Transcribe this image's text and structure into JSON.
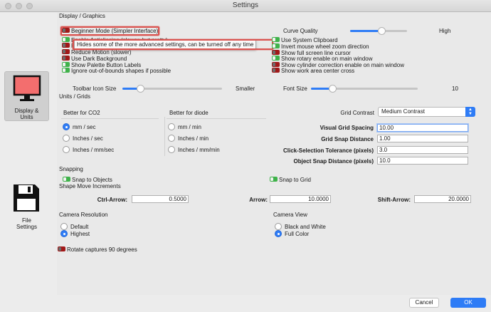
{
  "window": {
    "title": "Settings"
  },
  "sidebar": {
    "items": [
      {
        "label_1": "Display &",
        "label_2": "Units",
        "icon": "monitor-icon",
        "active": true
      },
      {
        "label_1": "File",
        "label_2": "Settings",
        "icon": "floppy-disk-icon",
        "active": false
      }
    ]
  },
  "display": {
    "header": "Display / Graphics",
    "left_checks": [
      {
        "label": "Beginner Mode (Simpler Interface)",
        "on": false
      },
      {
        "label": "Enable Antialiasing (slower, but pretty)",
        "on": true
      },
      {
        "label": "Fill",
        "on": false
      },
      {
        "label": "Reduce Motion (slower)",
        "on": false
      },
      {
        "label": "Use Dark Background",
        "on": false
      },
      {
        "label": "Show Palette Button Labels",
        "on": true
      },
      {
        "label": "Ignore out-of-bounds shapes if possible",
        "on": true
      }
    ],
    "tooltip": "Hides some of the more advanced settings, can be turned off any time",
    "curve_quality": {
      "label": "Curve Quality",
      "high_label": "High",
      "value": 0.55
    },
    "right_checks": [
      {
        "label": "Use System Clipboard",
        "on": true
      },
      {
        "label": "Invert mouse wheel zoom direction",
        "on": true
      },
      {
        "label": "Show full screen line cursor",
        "on": false
      },
      {
        "label": "Show rotary enable on main window",
        "on": true
      },
      {
        "label": "Show cylinder correction enable on main window",
        "on": false
      },
      {
        "label": "Show work area center cross",
        "on": false
      }
    ],
    "toolbar_icon_size": {
      "label": "Toolbar Icon Size",
      "smaller_label": "Smaller",
      "value": 0.18
    },
    "font_size": {
      "label": "Font Size",
      "value_label": "10",
      "value": 0.2
    }
  },
  "units": {
    "header": "Units / Grids",
    "better_co2": {
      "label": "Better for CO2",
      "options": [
        "mm / sec",
        "Inches / sec",
        "Inches / mm/sec"
      ],
      "selected": 0
    },
    "better_diode": {
      "label": "Better for diode",
      "options": [
        "mm / min",
        "Inches / min",
        "Inches / mm/min"
      ],
      "selected": -1
    },
    "grid_contrast": {
      "label": "Grid Contrast",
      "value": "Medium Contrast"
    },
    "fields": [
      {
        "label": "Visual Grid Spacing",
        "value": "10.00"
      },
      {
        "label": "Grid Snap Distance",
        "value": "1.00"
      },
      {
        "label": "Click-Selection Tolerance (pixels)",
        "value": "3.0"
      },
      {
        "label": "Object Snap Distance (pixels)",
        "value": "10.0"
      }
    ]
  },
  "snapping": {
    "header": "Snapping",
    "snap_objects": {
      "label": "Snap to Objects",
      "on": true
    },
    "snap_grid": {
      "label": "Snap to Grid",
      "on": true
    },
    "shape_move_header": "Shape Move Increments",
    "ctrl_arrow": {
      "label": "Ctrl-Arrow:",
      "value": "0.5000"
    },
    "arrow": {
      "label": "Arrow:",
      "value": "10.0000"
    },
    "shift_arrow": {
      "label": "Shift-Arrow:",
      "value": "20.0000"
    }
  },
  "camera": {
    "resolution_label": "Camera Resolution",
    "resolution_options": [
      "Default",
      "Highest"
    ],
    "resolution_selected": 1,
    "view_label": "Camera View",
    "view_options": [
      "Black and White",
      "Full Color"
    ],
    "view_selected": 1,
    "rotate": {
      "label": "Rotate captures 90 degrees",
      "on": false
    }
  },
  "buttons": {
    "cancel": "Cancel",
    "ok": "OK"
  },
  "colors": {
    "accent": "#2e7cf6",
    "toggle_on": "#3fb24a",
    "toggle_off": "#a11818",
    "highlight": "#d9534f"
  }
}
